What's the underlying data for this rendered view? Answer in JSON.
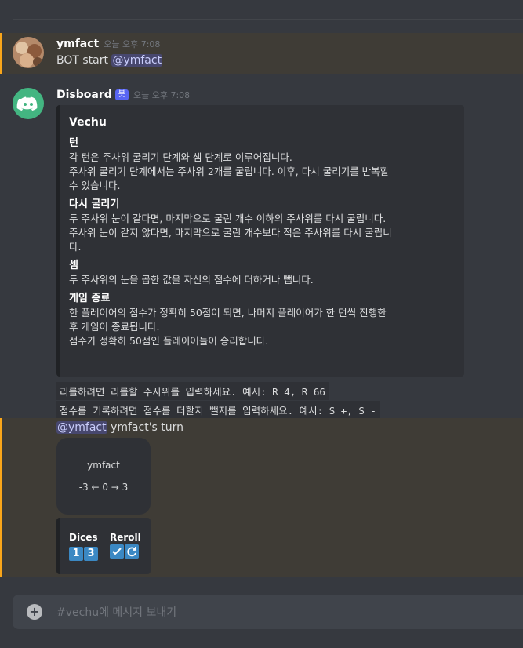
{
  "messages": [
    {
      "author": "ymfact",
      "timestamp": "오늘 오후 7:08",
      "text_prefix": "BOT start ",
      "mention": "@ymfact"
    },
    {
      "author": "Disboard",
      "bot_badge": "봇",
      "timestamp": "오늘 오후 7:08"
    }
  ],
  "embed": {
    "title": "Vechu",
    "fields": [
      {
        "name": "턴",
        "lines": [
          "각 턴은 주사위 굴리기 단계와 셈 단계로 이루어집니다.",
          "주사위 굴리기 단계에서는 주사위 2개를 굴립니다. 이후, 다시 굴리기를 반복할",
          "수 있습니다."
        ]
      },
      {
        "name": "다시 굴리기",
        "lines": [
          "두 주사위 눈이 같다면, 마지막으로 굴린 개수 이하의 주사위를 다시 굴립니다.",
          "주사위 눈이 같지 않다면, 마지막으로 굴린 개수보다 적은 주사위를 다시 굴립니",
          "다."
        ]
      },
      {
        "name": "셈",
        "lines": [
          "두 주사위의 눈을 곱한 값을 자신의 점수에 더하거나 뺍니다."
        ]
      },
      {
        "name": "게임 종료",
        "lines": [
          "한 플레이어의 점수가 정확히 50점이 되면, 나머지 플레이어가 한 턴씩 진행한",
          "후 게임이 종료됩니다.",
          "점수가 정확히 50점인 플레이어들이 승리합니다."
        ]
      }
    ]
  },
  "code_lines": [
    "리롤하려면 리롤할 주사위를 입력하세요. 예시: R 4, R 66",
    "점수를 기록하려면 점수를 더할지 뺄지를 입력하세요. 예시: S +, S -"
  ],
  "turn": {
    "mention": "@ymfact",
    "text": " ymfact's turn"
  },
  "score_card": {
    "name": "ymfact",
    "score": "-3 ← 0 → 3"
  },
  "dice_embed": {
    "dices_label": "Dices",
    "reroll_label": "Reroll",
    "dice": [
      "1",
      "3"
    ],
    "reroll_icons": [
      "check-icon",
      "refresh-icon"
    ]
  },
  "input": {
    "placeholder": "#vechu에 메시지 보내기"
  },
  "colors": {
    "mention_bar": "#faa61a",
    "accent": "#5865f2",
    "discord_green": "#43b581"
  }
}
